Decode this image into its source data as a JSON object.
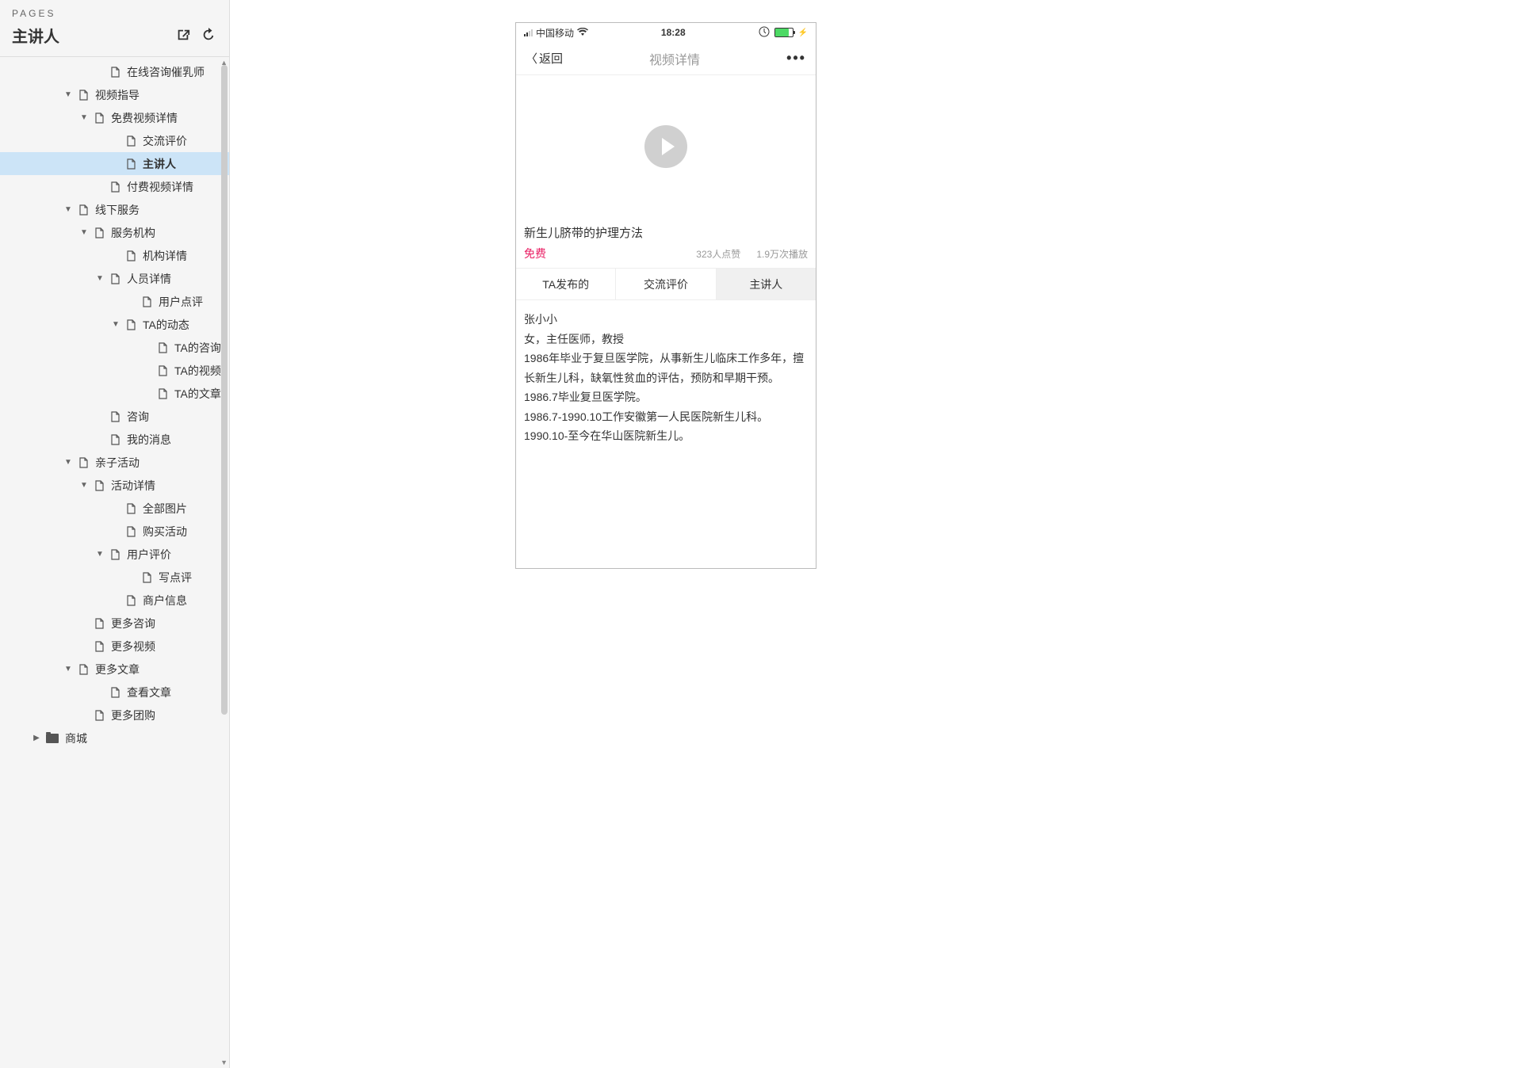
{
  "sidebar": {
    "section_label": "PAGES",
    "title": "主讲人",
    "tree": [
      {
        "indent": 120,
        "toggle": "",
        "type": "page",
        "label": "在线咨询催乳师",
        "selected": false
      },
      {
        "indent": 80,
        "toggle": "▼",
        "type": "page",
        "label": "视频指导",
        "selected": false
      },
      {
        "indent": 100,
        "toggle": "▼",
        "type": "page",
        "label": "免费视频详情",
        "selected": false
      },
      {
        "indent": 140,
        "toggle": "",
        "type": "page",
        "label": "交流评价",
        "selected": false
      },
      {
        "indent": 140,
        "toggle": "",
        "type": "page",
        "label": "主讲人",
        "selected": true
      },
      {
        "indent": 120,
        "toggle": "",
        "type": "page",
        "label": "付费视频详情",
        "selected": false
      },
      {
        "indent": 80,
        "toggle": "▼",
        "type": "page",
        "label": "线下服务",
        "selected": false
      },
      {
        "indent": 100,
        "toggle": "▼",
        "type": "page",
        "label": "服务机构",
        "selected": false
      },
      {
        "indent": 140,
        "toggle": "",
        "type": "page",
        "label": "机构详情",
        "selected": false
      },
      {
        "indent": 120,
        "toggle": "▼",
        "type": "page",
        "label": "人员详情",
        "selected": false
      },
      {
        "indent": 160,
        "toggle": "",
        "type": "page",
        "label": "用户点评",
        "selected": false
      },
      {
        "indent": 140,
        "toggle": "▼",
        "type": "page",
        "label": "TA的动态",
        "selected": false
      },
      {
        "indent": 180,
        "toggle": "",
        "type": "page",
        "label": "TA的咨询",
        "selected": false
      },
      {
        "indent": 180,
        "toggle": "",
        "type": "page",
        "label": "TA的视频",
        "selected": false
      },
      {
        "indent": 180,
        "toggle": "",
        "type": "page",
        "label": "TA的文章",
        "selected": false
      },
      {
        "indent": 120,
        "toggle": "",
        "type": "page",
        "label": "咨询",
        "selected": false
      },
      {
        "indent": 120,
        "toggle": "",
        "type": "page",
        "label": "我的消息",
        "selected": false
      },
      {
        "indent": 80,
        "toggle": "▼",
        "type": "page",
        "label": "亲子活动",
        "selected": false
      },
      {
        "indent": 100,
        "toggle": "▼",
        "type": "page",
        "label": "活动详情",
        "selected": false
      },
      {
        "indent": 140,
        "toggle": "",
        "type": "page",
        "label": "全部图片",
        "selected": false
      },
      {
        "indent": 140,
        "toggle": "",
        "type": "page",
        "label": "购买活动",
        "selected": false
      },
      {
        "indent": 120,
        "toggle": "▼",
        "type": "page",
        "label": "用户评价",
        "selected": false
      },
      {
        "indent": 160,
        "toggle": "",
        "type": "page",
        "label": "写点评",
        "selected": false
      },
      {
        "indent": 140,
        "toggle": "",
        "type": "page",
        "label": "商户信息",
        "selected": false
      },
      {
        "indent": 100,
        "toggle": "",
        "type": "page",
        "label": "更多咨询",
        "selected": false
      },
      {
        "indent": 100,
        "toggle": "",
        "type": "page",
        "label": "更多视频",
        "selected": false
      },
      {
        "indent": 80,
        "toggle": "▼",
        "type": "page",
        "label": "更多文章",
        "selected": false
      },
      {
        "indent": 120,
        "toggle": "",
        "type": "page",
        "label": "查看文章",
        "selected": false
      },
      {
        "indent": 100,
        "toggle": "",
        "type": "page",
        "label": "更多团购",
        "selected": false
      },
      {
        "indent": 40,
        "toggle": "▶",
        "type": "folder",
        "label": "商城",
        "selected": false
      }
    ]
  },
  "phone": {
    "status": {
      "carrier": "中国移动",
      "time": "18:28"
    },
    "nav": {
      "back": "返回",
      "title": "视频详情",
      "more": "•••"
    },
    "video": {
      "title": "新生儿脐带的护理方法",
      "free": "免费",
      "likes": "323人点赞",
      "plays": "1.9万次播放"
    },
    "tabs": [
      {
        "label": "TA发布的",
        "active": false
      },
      {
        "label": "交流评价",
        "active": false
      },
      {
        "label": "主讲人",
        "active": true
      }
    ],
    "content": {
      "name": "张小小",
      "line1": "女，主任医师，教授",
      "line2": "1986年毕业于复旦医学院，从事新生儿临床工作多年，擅长新生儿科，缺氧性贫血的评估，预防和早期干预。",
      "line3": "1986.7毕业复旦医学院。",
      "line4": "1986.7-1990.10工作安徽第一人民医院新生儿科。",
      "line5": "1990.10-至今在华山医院新生儿。"
    }
  }
}
